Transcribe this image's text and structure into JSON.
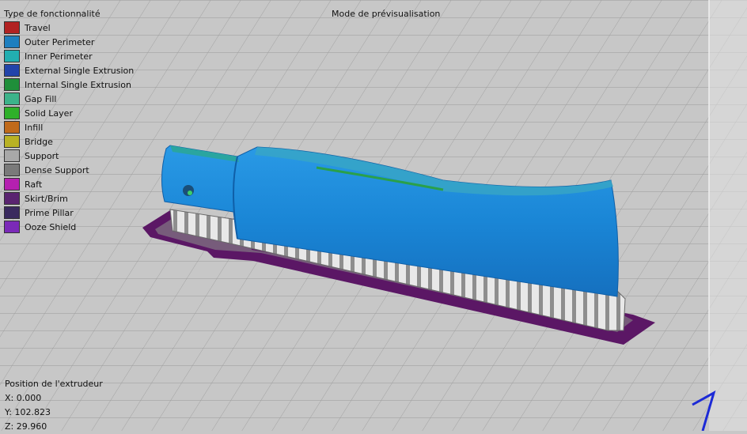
{
  "legend": {
    "title": "Type de fonctionnalité",
    "items": [
      {
        "label": "Travel",
        "color": "#b22222"
      },
      {
        "label": "Outer Perimeter",
        "color": "#1e7fbf"
      },
      {
        "label": "Inner Perimeter",
        "color": "#22aeb0"
      },
      {
        "label": "External Single Extrusion",
        "color": "#2244aa"
      },
      {
        "label": "Internal Single Extrusion",
        "color": "#1f8f3a"
      },
      {
        "label": "Gap Fill",
        "color": "#3cb38a"
      },
      {
        "label": "Solid Layer",
        "color": "#2fb02a"
      },
      {
        "label": "Infill",
        "color": "#c06a1a"
      },
      {
        "label": "Bridge",
        "color": "#b9b224"
      },
      {
        "label": "Support",
        "color": "#a8a8a8"
      },
      {
        "label": "Dense Support",
        "color": "#7a7a7a"
      },
      {
        "label": "Raft",
        "color": "#b520b0"
      },
      {
        "label": "Skirt/Brim",
        "color": "#5a2470"
      },
      {
        "label": "Prime Pillar",
        "color": "#3a2a5e"
      },
      {
        "label": "Ooze Shield",
        "color": "#7b2ab8"
      }
    ]
  },
  "mode": {
    "title": "Mode de prévisualisation"
  },
  "extruder": {
    "title": "Position de l'extrudeur",
    "x": "X: 0.000",
    "y": "Y: 102.823",
    "z": "Z: 29.960"
  }
}
